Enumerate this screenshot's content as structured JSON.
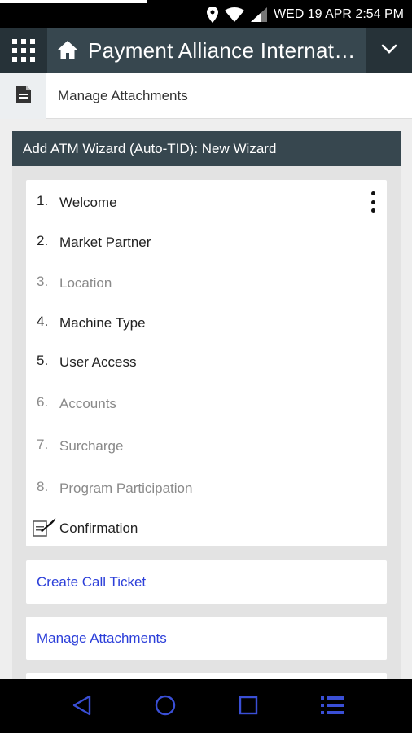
{
  "status_bar": {
    "datetime": "WED 19 APR 2:54 PM",
    "icons": [
      "location-icon",
      "wifi-icon",
      "signal-icon"
    ]
  },
  "app_header": {
    "title": "Payment Alliance Internat…",
    "icons": [
      "grid-menu-icon",
      "home-icon",
      "chevron-down-icon"
    ]
  },
  "sub_header": {
    "title": "Manage Attachments",
    "icon": "document-icon"
  },
  "wizard": {
    "header": "Add ATM Wizard (Auto-TID): New Wizard",
    "steps": [
      {
        "num": "1.",
        "label": "Welcome",
        "state": "enabled"
      },
      {
        "num": "2.",
        "label": "Market Partner",
        "state": "enabled"
      },
      {
        "num": "3.",
        "label": "Location",
        "state": "disabled"
      },
      {
        "num": "4.",
        "label": "Machine Type",
        "state": "enabled"
      },
      {
        "num": "5.",
        "label": "User Access",
        "state": "enabled"
      },
      {
        "num": "6.",
        "label": "Accounts",
        "state": "disabled"
      },
      {
        "num": "7.",
        "label": "Surcharge",
        "state": "disabled"
      },
      {
        "num": "8.",
        "label": "Program Participation",
        "state": "disabled"
      }
    ],
    "confirmation": {
      "label": "Confirmation",
      "icon": "sign-document-icon"
    }
  },
  "links": [
    {
      "label": "Create Call Ticket"
    },
    {
      "label": "Manage Attachments"
    }
  ],
  "nav_bar": {
    "icons": [
      "back-icon",
      "home-circle-icon",
      "recents-icon",
      "menu-list-icon"
    ]
  },
  "colors": {
    "header_bg": "#37474f",
    "header_dark": "#263238",
    "link": "#2c3fd9",
    "disabled_text": "#8a8a8a"
  }
}
